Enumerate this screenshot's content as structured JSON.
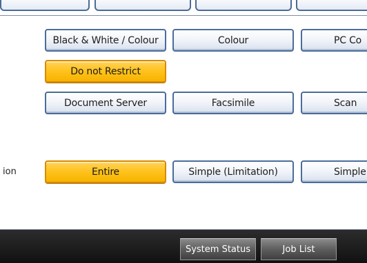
{
  "buttons": {
    "row1": [
      "Black & White / Colour",
      "Colour",
      "PC Co"
    ],
    "row2": [
      "Do not Restrict"
    ],
    "row3": [
      "Document Server",
      "Facsimile",
      "Scan"
    ],
    "row4": [
      "Entire",
      "Simple (Limitation)",
      "Simple"
    ]
  },
  "side_label": "ion",
  "status_bar": {
    "system_status": "System Status",
    "job_list": "Job List"
  },
  "colors": {
    "selected": "#ffc21c",
    "button_border": "#4a6c9a",
    "bottom_bar": "#1a1a1a"
  }
}
